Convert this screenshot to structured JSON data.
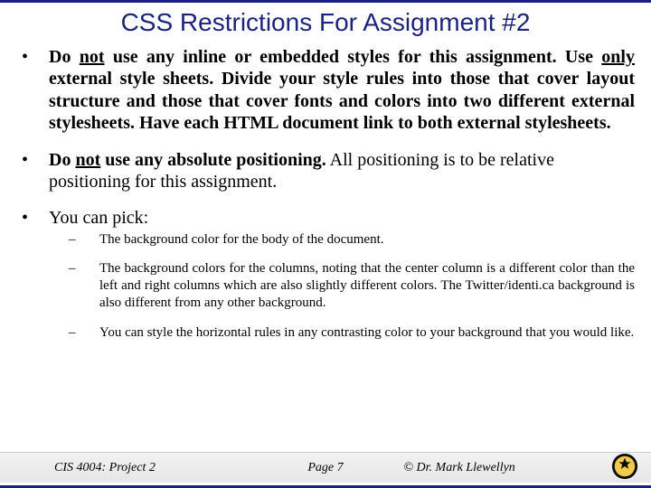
{
  "title": "CSS Restrictions For Assignment #2",
  "bullets": [
    {
      "pre": "Do ",
      "u1": "not",
      "mid1": " use any inline or embedded styles for this assignment. Use ",
      "u2": "only",
      "post": " external style sheets.  Divide your style rules into those that cover layout structure and those that cover fonts and colors into two different external stylesheets.  Have each HTML document link to both external stylesheets."
    },
    {
      "pre": "Do ",
      "u1": "not",
      "mid1": " use any absolute positioning.",
      "post": "  All positioning is to be relative positioning for this assignment."
    },
    {
      "text": "You can pick:"
    }
  ],
  "sub": [
    "The background color for the body of the document.",
    "The background colors for the columns, noting that the center column is a different color than the left and right columns which are also slightly different colors. The Twitter/identi.ca background is also different from any other background.",
    "You can style the horizontal rules in any contrasting color to your background that you would like."
  ],
  "footer": {
    "left": "CIS 4004: Project 2",
    "center": "Page 7",
    "right": "© Dr. Mark Llewellyn"
  }
}
